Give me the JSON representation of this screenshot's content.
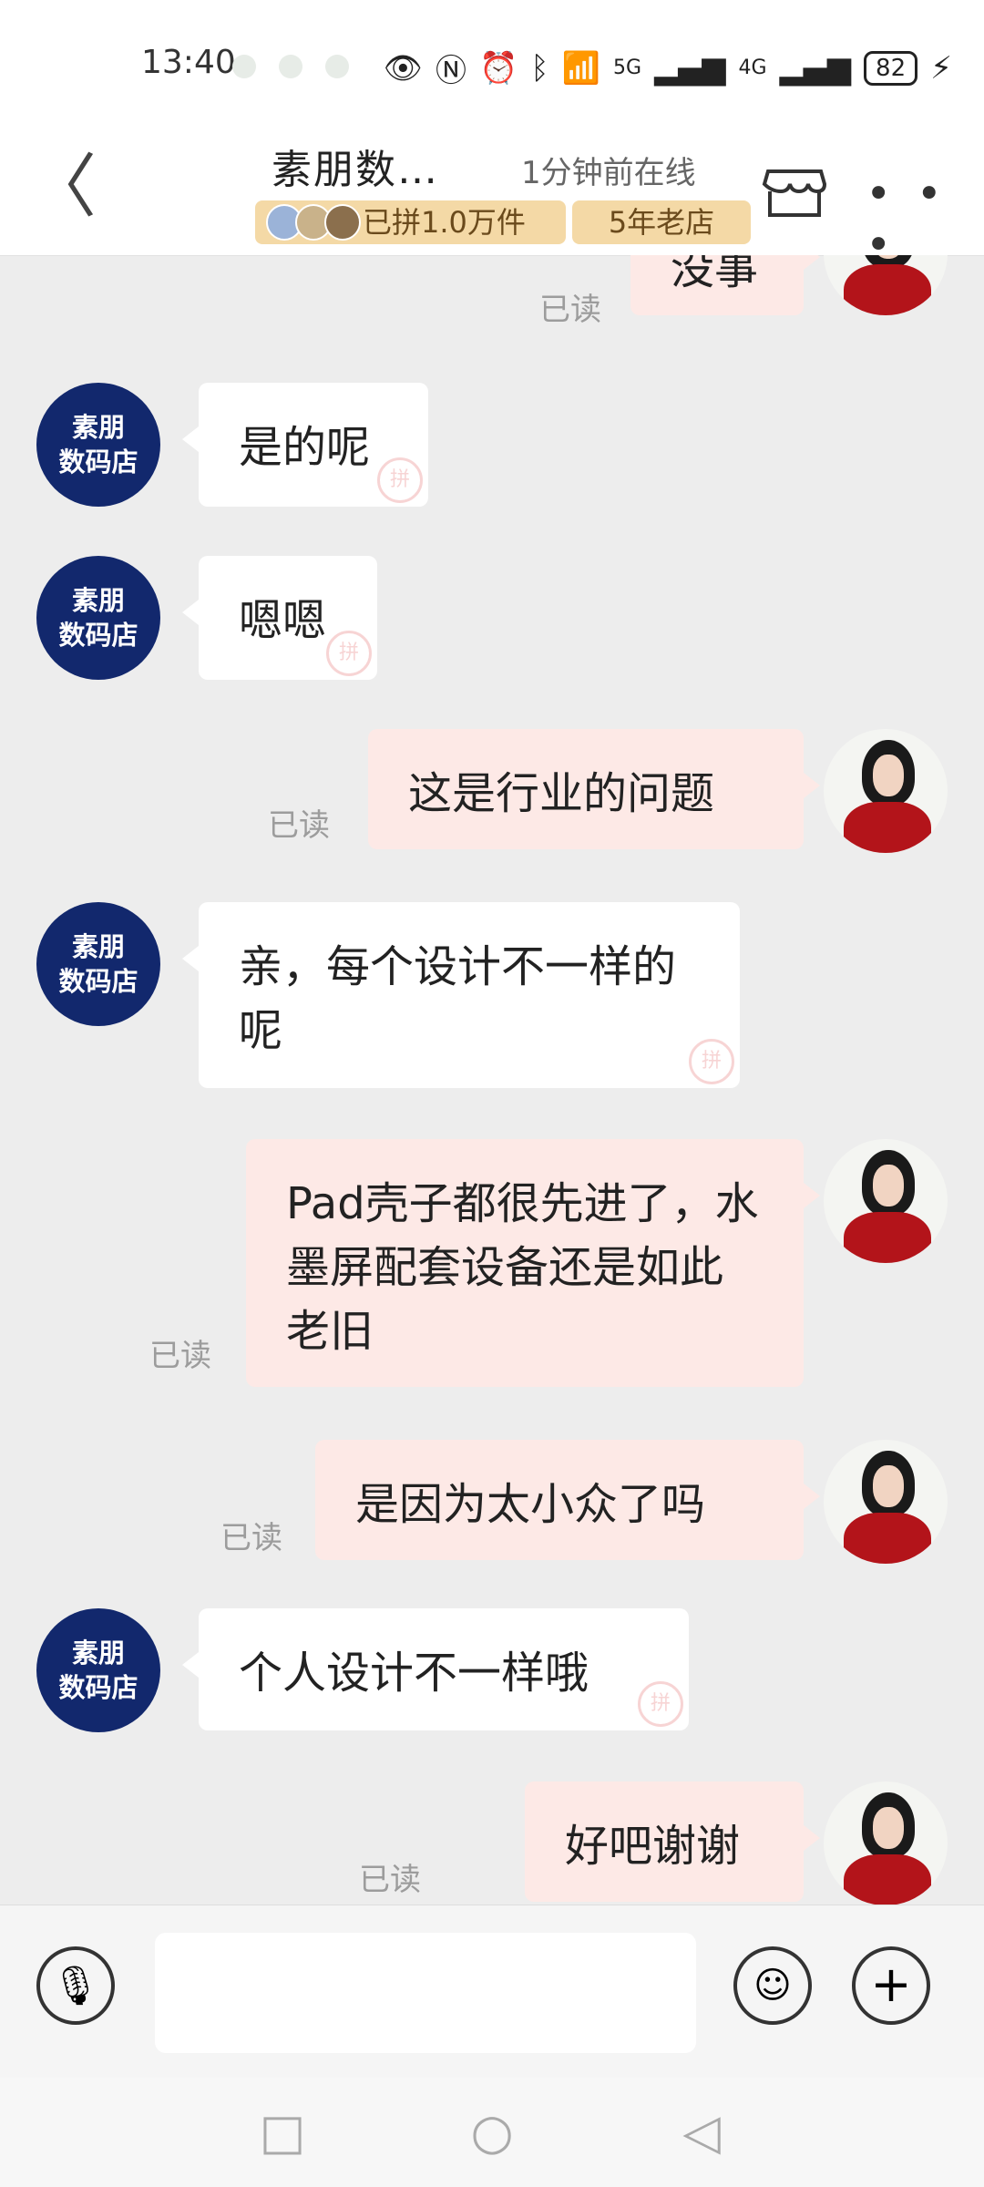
{
  "status": {
    "time": "13:40",
    "network1": "5G",
    "network2": "4G",
    "battery": "82"
  },
  "header": {
    "title": "素朋数…",
    "online": "1分钟前在线",
    "badge_pinned": "已拼1.0万件",
    "badge_store_age": "5年老店"
  },
  "messages": [
    {
      "side": "right",
      "text": "没事",
      "read": "已读"
    },
    {
      "side": "left",
      "avatar": [
        "素朋",
        "数码店"
      ],
      "text": "是的呢",
      "watermark": "拼"
    },
    {
      "side": "left",
      "avatar": [
        "素朋",
        "数码店"
      ],
      "text": "嗯嗯",
      "watermark": "拼"
    },
    {
      "side": "right",
      "text": "这是行业的问题",
      "read": "已读"
    },
    {
      "side": "left",
      "avatar": [
        "素朋",
        "数码店"
      ],
      "text": "亲，每个设计不一样的呢",
      "watermark": "拼"
    },
    {
      "side": "right",
      "text": "Pad壳子都很先进了，水墨屏配套设备还是如此老旧",
      "read": "已读"
    },
    {
      "side": "right",
      "text": "是因为太小众了吗",
      "read": "已读"
    },
    {
      "side": "left",
      "avatar": [
        "素朋",
        "数码店"
      ],
      "text": "个人设计不一样哦",
      "watermark": "拼"
    },
    {
      "side": "right",
      "text": "好吧谢谢",
      "read": "已读"
    }
  ],
  "input": {
    "placeholder": ""
  }
}
